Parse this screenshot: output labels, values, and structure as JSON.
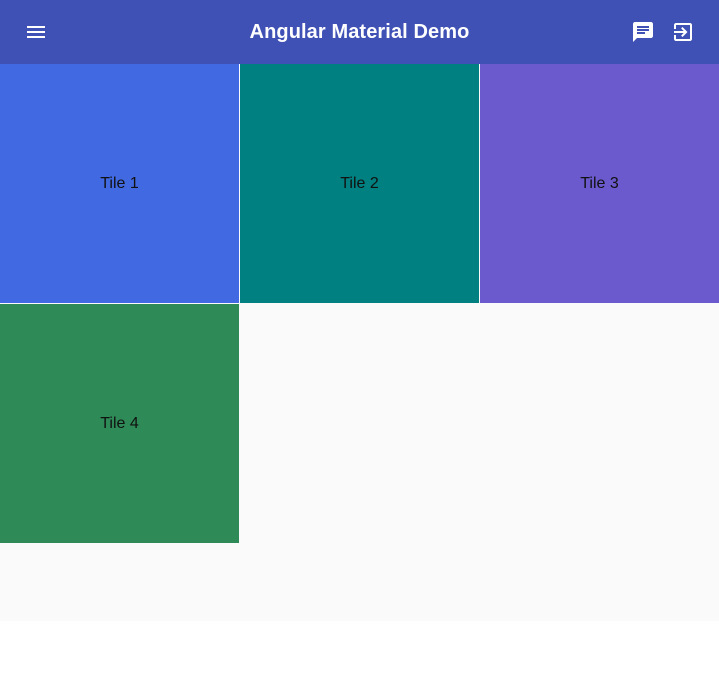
{
  "toolbar": {
    "title": "Angular Material Demo",
    "background": "#3f51b5",
    "menu_icon": "menu-icon",
    "chat_icon": "chat-icon",
    "exit_icon": "exit-to-app-icon"
  },
  "grid": {
    "tiles": [
      {
        "label": "Tile 1",
        "color": "#4169e1"
      },
      {
        "label": "Tile 2",
        "color": "#008080"
      },
      {
        "label": "Tile 3",
        "color": "#6a5acd"
      },
      {
        "label": "Tile 4",
        "color": "#2e8b57"
      }
    ]
  }
}
